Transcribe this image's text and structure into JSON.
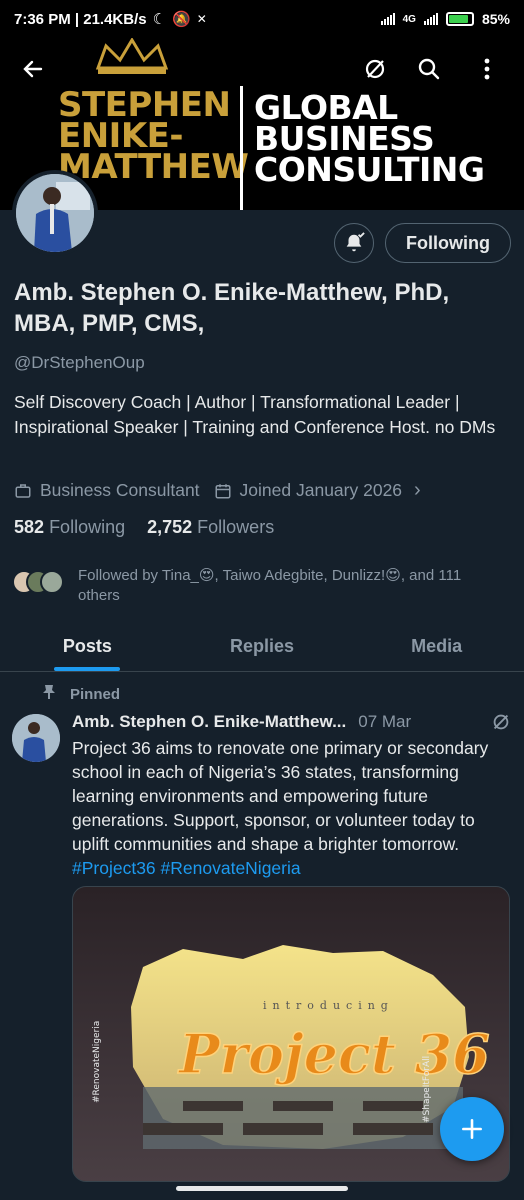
{
  "status_bar": {
    "time_speed": "7:36 PM | 21.4KB/s",
    "network": "4G",
    "battery": "85%"
  },
  "banner": {
    "left_lines": [
      "STEPHEN",
      "ENIKE-",
      "MATTHEW"
    ],
    "right_lines": [
      "GLOBAL",
      "BUSINESS",
      "CONSULTING"
    ]
  },
  "profile": {
    "follow_button": "Following",
    "name": "Amb. Stephen O. Enike-Matthew, PhD, MBA, PMP, CMS,",
    "handle": "@DrStephenOup",
    "bio": "Self Discovery Coach | Author | Transformational Leader | Inspirational Speaker | Training and Conference Host. no DMs",
    "category": "Business Consultant",
    "joined": "Joined January 2026",
    "following_count": "582",
    "following_label": "Following",
    "followers_count": "2,752",
    "followers_label": "Followers",
    "followed_by": "Followed by Tina_😍, Taiwo Adegbite, Dunlizz!😍, and 111 others"
  },
  "tabs": [
    "Posts",
    "Replies",
    "Media"
  ],
  "post": {
    "pinned_label": "Pinned",
    "author": "Amb. Stephen O. Enike-Matthew...",
    "date": "07 Mar",
    "text": "Project 36 aims to renovate one primary or secondary school in each of Nigeria’s 36 states, transforming learning environments and empowering future generations. Support, sponsor, or volunteer today to uplift communities and shape a brighter tomorrow.",
    "hashtags": "#Project36 #RenovateNigeria",
    "image_intro": "introducing",
    "image_title": "Project 36",
    "image_side_left": "#RenovateNigeria",
    "image_side_right": "#ShapeItForAll"
  },
  "colors": {
    "background": "#15202b",
    "accent": "#1d9bf0",
    "banner_gold": "#c9a03a"
  },
  "icons": [
    "back-arrow-icon",
    "grok-icon",
    "search-icon",
    "more-vertical-icon",
    "bell-add-icon",
    "briefcase-icon",
    "calendar-icon",
    "chevron-right-icon",
    "pin-icon",
    "plus-icon"
  ]
}
